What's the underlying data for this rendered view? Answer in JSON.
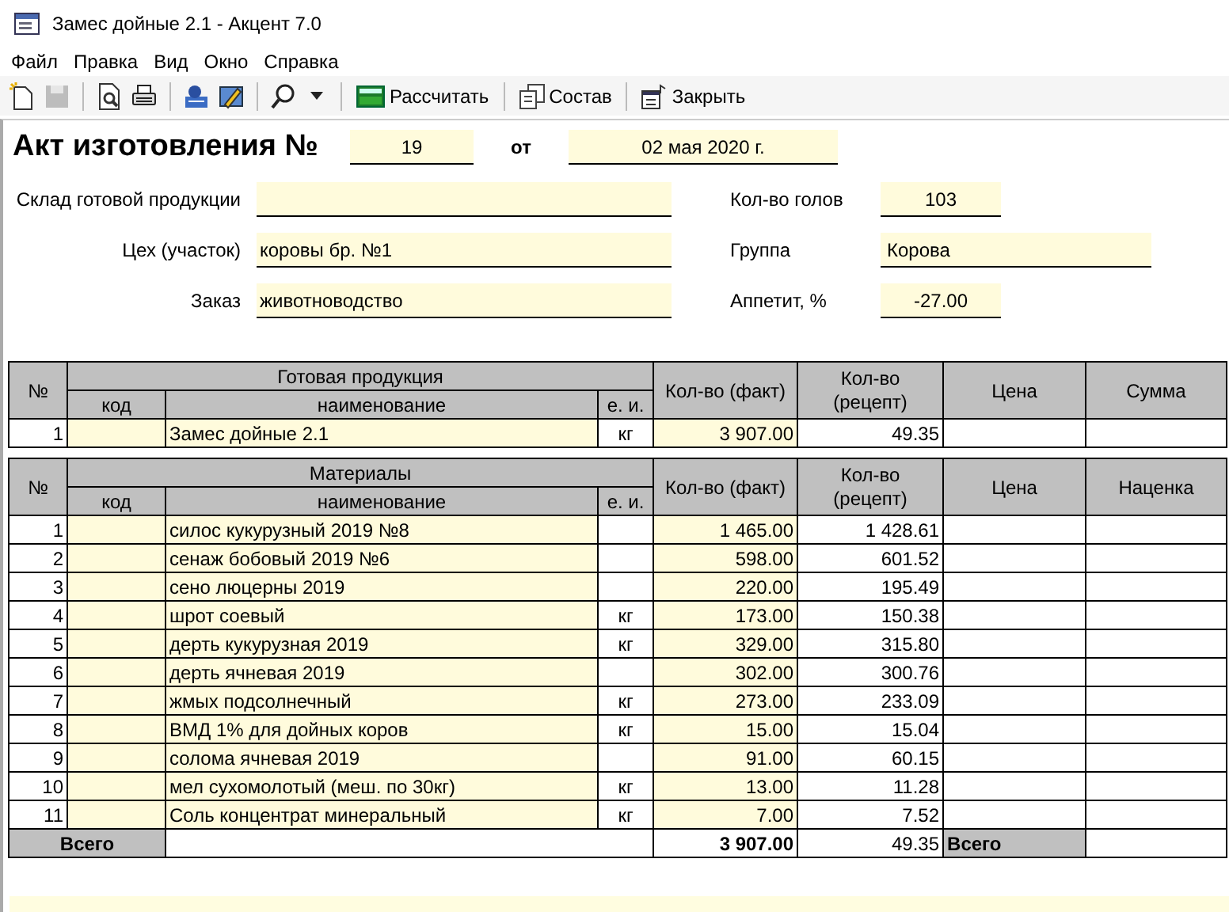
{
  "window": {
    "title": "Замес дойные 2.1 - Акцент 7.0"
  },
  "menu": [
    "Файл",
    "Правка",
    "Вид",
    "Окно",
    "Справка"
  ],
  "toolbar": [
    {
      "kind": "new",
      "disabled": false
    },
    {
      "kind": "save",
      "disabled": true
    },
    {
      "kind": "sep"
    },
    {
      "kind": "preview",
      "disabled": false
    },
    {
      "kind": "print",
      "disabled": false
    },
    {
      "kind": "sep"
    },
    {
      "kind": "net",
      "disabled": false
    },
    {
      "kind": "edit",
      "disabled": false
    },
    {
      "kind": "sep"
    },
    {
      "kind": "search",
      "disabled": false
    },
    {
      "kind": "caret",
      "disabled": false
    },
    {
      "kind": "sep"
    },
    {
      "kind": "calc",
      "label": "Рассчитать",
      "disabled": false
    },
    {
      "kind": "sep"
    },
    {
      "kind": "compose",
      "label": "Состав",
      "disabled": false
    },
    {
      "kind": "sep"
    },
    {
      "kind": "close",
      "label": "Закрыть",
      "disabled": false
    }
  ],
  "header": {
    "title": "Акт изготовления №",
    "number": "19",
    "from_label": "от",
    "date": "02 мая 2020 г."
  },
  "fields_left": [
    {
      "label": "Склад готовой продукции"
    },
    {
      "label": "Цех (участок)",
      "value": "коровы бр. №1"
    },
    {
      "label": "Заказ",
      "value": "животноводство"
    }
  ],
  "fields_right": [
    {
      "label": "Кол-во голов",
      "value": "103",
      "kind": "number"
    },
    {
      "label": "Группа",
      "value": "Корова",
      "kind": "text"
    },
    {
      "label": "Аппетит, %",
      "value": "-27.00",
      "kind": "number"
    }
  ],
  "product_table": {
    "columns": [
      "№",
      "Готовая продукция",
      "код",
      "наименование",
      "е. и.",
      "Кол-во (факт)",
      "Кол-во (рецепт)",
      "Цена",
      "Сумма"
    ],
    "rows": [
      {
        "no": "1",
        "name": "Замес дойные 2.1",
        "unit": "кг",
        "fact": "3 907.00",
        "recipe": "49.35"
      }
    ]
  },
  "materials_table": {
    "columns": [
      "№",
      "Материалы",
      "код",
      "наименование",
      "е. и.",
      "Кол-во (факт)",
      "Кол-во (рецепт)",
      "Цена",
      "Наценка"
    ],
    "rows": [
      {
        "no": "1",
        "name": "силос кукурузный 2019 №8",
        "fact": "1 465.00",
        "recipe": "1 428.61"
      },
      {
        "no": "2",
        "name": "сенаж бобовый 2019 №6",
        "fact": "598.00",
        "recipe": "601.52"
      },
      {
        "no": "3",
        "name": "сено люцерны 2019",
        "fact": "220.00",
        "recipe": "195.49"
      },
      {
        "no": "4",
        "name": "шрот соевый",
        "unit": "кг",
        "fact": "173.00",
        "recipe": "150.38"
      },
      {
        "no": "5",
        "name": "дерть кукурузная 2019",
        "unit": "кг",
        "fact": "329.00",
        "recipe": "315.80"
      },
      {
        "no": "6",
        "name": "дерть ячневая 2019",
        "fact": "302.00",
        "recipe": "300.76"
      },
      {
        "no": "7",
        "name": "жмых подсолнечный",
        "unit": "кг",
        "fact": "273.00",
        "recipe": "233.09"
      },
      {
        "no": "8",
        "name": "ВМД 1% для дойных коров",
        "unit": "кг",
        "fact": "15.00",
        "recipe": "15.04"
      },
      {
        "no": "9",
        "name": "солома ячневая 2019",
        "fact": "91.00",
        "recipe": "60.15"
      },
      {
        "no": "10",
        "name": "мел сухомолотый (меш. по 30кг)",
        "unit": "кг",
        "fact": "13.00",
        "recipe": "11.28"
      },
      {
        "no": "11",
        "name": "Соль концентрат минеральный",
        "unit": "кг",
        "fact": "7.00",
        "recipe": "7.52"
      }
    ],
    "total": {
      "label": "Всего",
      "fact": "3 907.00",
      "recipe": "49.35",
      "price_label": "Всего"
    }
  }
}
